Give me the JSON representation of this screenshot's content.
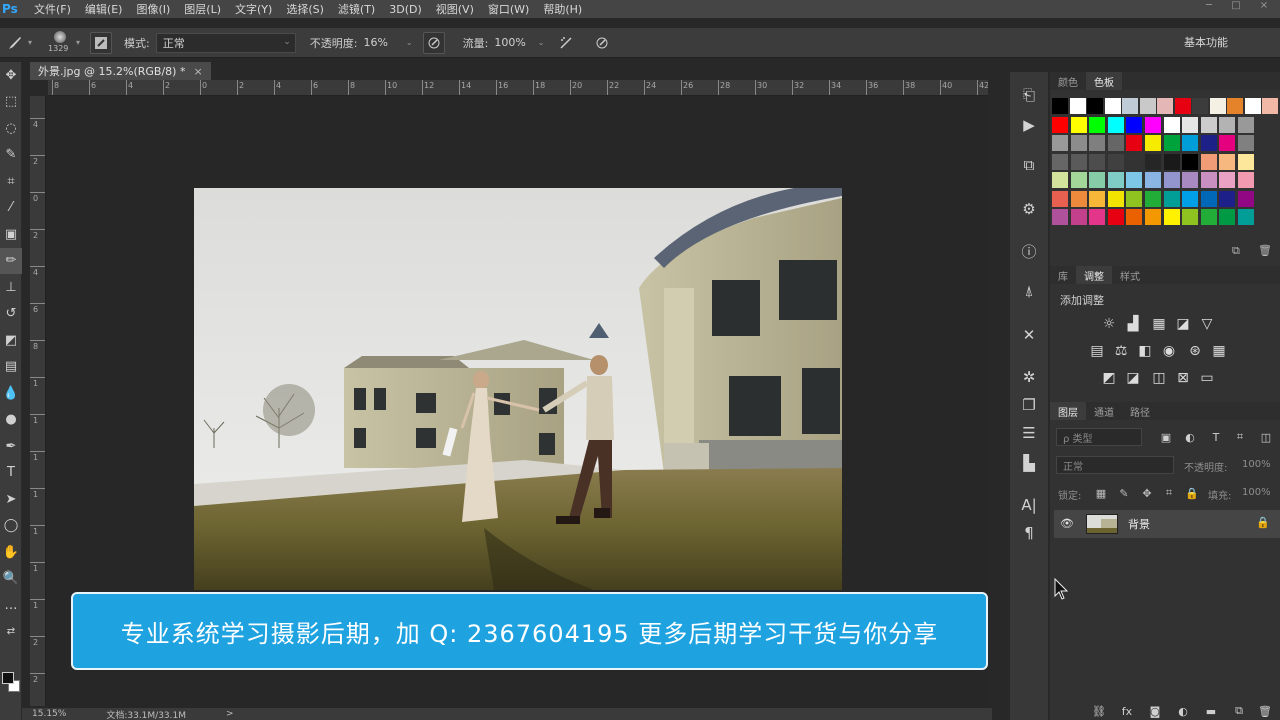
{
  "app": {
    "logo": "Ps"
  },
  "menu": [
    "文件(F)",
    "编辑(E)",
    "图像(I)",
    "图层(L)",
    "文字(Y)",
    "选择(S)",
    "滤镜(T)",
    "3D(D)",
    "视图(V)",
    "窗口(W)",
    "帮助(H)"
  ],
  "options": {
    "brush_size": "1329",
    "mode_label": "模式:",
    "mode_value": "正常",
    "opacity_label": "不透明度:",
    "opacity_value": "16%",
    "flow_label": "流量:",
    "flow_value": "100%"
  },
  "workspace": "基本功能",
  "document": {
    "tab_title": "外景.jpg @ 15.2%(RGB/8) *",
    "close": "×"
  },
  "ruler_h": [
    "8",
    "6",
    "4",
    "2",
    "0",
    "2",
    "4",
    "6",
    "8",
    "10",
    "12",
    "14",
    "16",
    "18",
    "20",
    "22",
    "24",
    "26",
    "28",
    "30",
    "32",
    "34",
    "36",
    "38",
    "40",
    "42"
  ],
  "ruler_v": [
    "4",
    "2",
    "0",
    "2",
    "4",
    "6",
    "8",
    "1",
    "1",
    "1",
    "1",
    "1",
    "1",
    "1",
    "2",
    "2",
    "2"
  ],
  "banner": {
    "text": "专业系统学习摄影后期，加 Q: 2367604195 更多后期学习干货与你分享"
  },
  "status": {
    "zoom": "15.15%",
    "doc": "文档:33.1M/33.1M",
    "arrow": ">"
  },
  "panels": {
    "color_tabs": [
      "颜色",
      "色板"
    ],
    "adj_tabs": [
      "库",
      "调整",
      "样式"
    ],
    "adj_title": "添加调整",
    "layers_tabs": [
      "图层",
      "通道",
      "路径"
    ],
    "filter_placeholder": "ρ 类型",
    "blend_mode": "正常",
    "opacity_label": "不透明度:",
    "opacity_value": "100%",
    "lock_label": "锁定:",
    "fill_label": "填充:",
    "fill_value": "100%",
    "layer_name": "背景"
  },
  "swatch_rows": [
    [
      "#000000",
      "#ffffff",
      "#000000",
      "#ffffff",
      "#bfcbd6",
      "#c9c9c9",
      "#e4b6b6",
      "#e60012",
      "#3c3c3c",
      "#f4f0e4",
      "#e4832a",
      "#ffffff",
      "#f1b8a8"
    ],
    [
      "#ff0000",
      "#ffff00",
      "#00ff00",
      "#00ffff",
      "#0000ff",
      "#ff00ff",
      "#ffffff",
      "#e6e6e6",
      "#cccccc",
      "#b3b3b3",
      "#999999"
    ],
    [
      "#999999",
      "#8c8c8c",
      "#7f7f7f",
      "#666666",
      "#e60012",
      "#f7ec00",
      "#00a23b",
      "#009ed8",
      "#1d2087",
      "#e4007f",
      "#808080"
    ],
    [
      "#666666",
      "#5a5a5a",
      "#4d4d4d",
      "#404040",
      "#333333",
      "#262626",
      "#1a1a1a",
      "#000000",
      "#f29c77",
      "#f7b880",
      "#fce79b"
    ],
    [
      "#d3e39c",
      "#a3d79a",
      "#86cda7",
      "#7fcbc6",
      "#7ec6e8",
      "#8ab4e1",
      "#9396cc",
      "#a88ac1",
      "#c98fc1",
      "#e9a1c4",
      "#f29ab0"
    ],
    [
      "#e8604f",
      "#ee8a3c",
      "#f6b738",
      "#f2e400",
      "#8fc31f",
      "#22ac38",
      "#009e96",
      "#00a0e9",
      "#0068b7",
      "#1d2088",
      "#920783"
    ],
    [
      "#b0529b",
      "#c3408c",
      "#e3368a",
      "#e60012",
      "#eb6100",
      "#f39800",
      "#fff100",
      "#8fc31f",
      "#22ac38",
      "#009944",
      "#009e96"
    ]
  ],
  "colors": {
    "banner": "#1ea2e0",
    "accent_ps": "#31a8ff"
  }
}
